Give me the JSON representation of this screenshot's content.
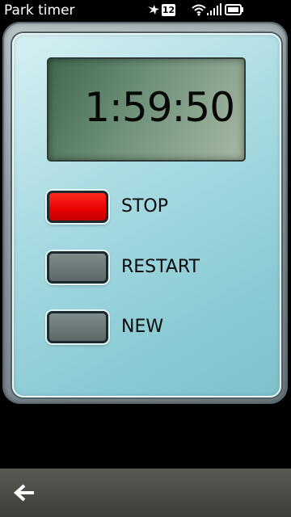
{
  "status_bar": {
    "app_title": "Park timer",
    "notification_count": "12"
  },
  "timer": {
    "display": "1:59:50"
  },
  "buttons": {
    "stop": {
      "label": "STOP",
      "color": "#e60000"
    },
    "restart": {
      "label": "RESTART",
      "color": "#6a7777"
    },
    "new": {
      "label": "NEW",
      "color": "#6a7777"
    }
  },
  "bottom_bar": {
    "back_icon": "back-arrow-icon"
  }
}
